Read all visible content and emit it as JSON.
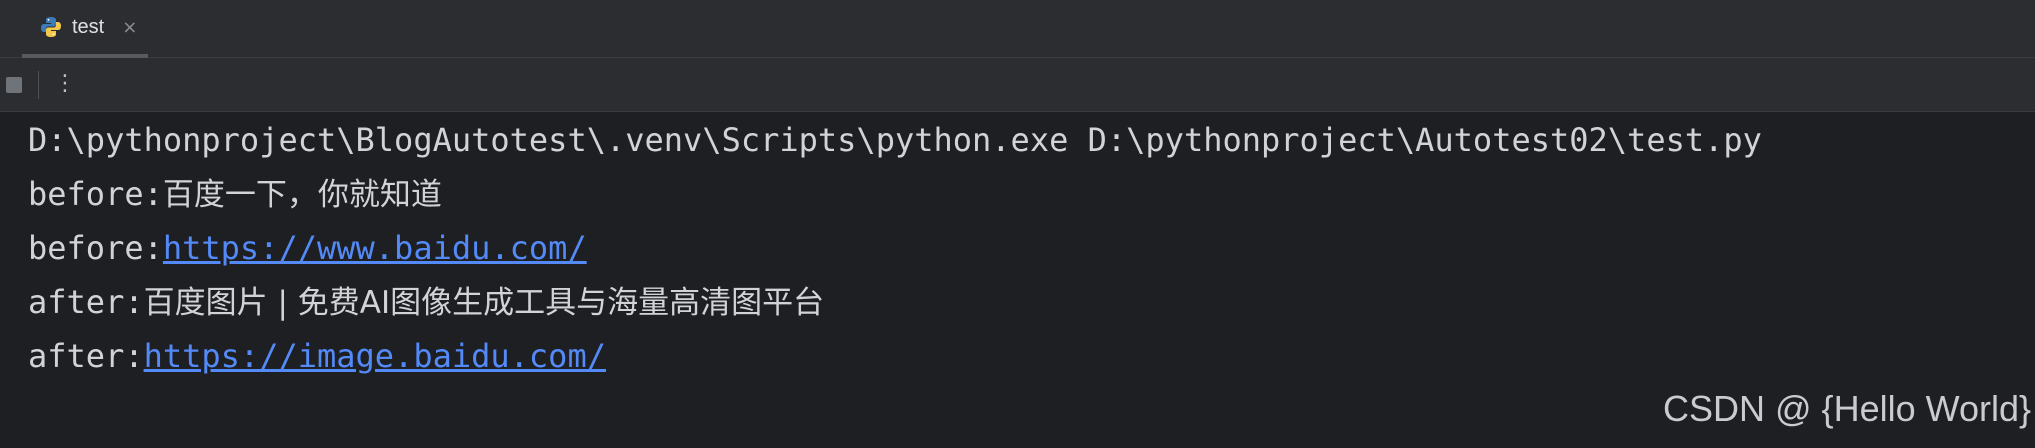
{
  "tab": {
    "label": "test",
    "close_glyph": "×",
    "icon": "python-icon"
  },
  "toolbar": {
    "stop_icon": "stop-icon",
    "more_glyph": "⋮"
  },
  "console": {
    "line1": "D:\\pythonproject\\BlogAutotest\\.venv\\Scripts\\python.exe D:\\pythonproject\\Autotest02\\test.py",
    "line2_prefix": "before:",
    "line2_value": "百度一下，你就知道",
    "line3_prefix": "before:",
    "line3_link": "https://www.baidu.com/",
    "line4_prefix": "after:",
    "line4_value": "百度图片 | 免费AI图像生成工具与海量高清图平台",
    "line5_prefix": "after:",
    "line5_link": "https://image.baidu.com/"
  },
  "watermark": "CSDN @ {Hello World}",
  "colors": {
    "link": "#548af7",
    "background": "#1e1f22",
    "panel": "#2b2d30"
  }
}
